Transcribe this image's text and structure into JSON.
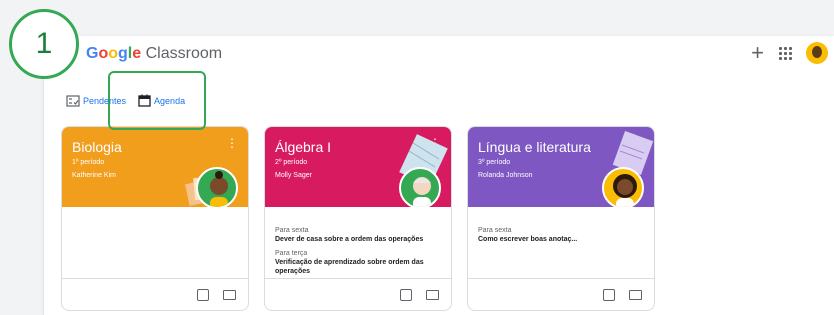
{
  "callout": {
    "number": "1"
  },
  "brand": {
    "title_parts": [
      "G",
      "o",
      "o",
      "g",
      "l",
      "e"
    ],
    "suffix": " Classroom"
  },
  "topbar": {
    "plus_label": "+"
  },
  "tabs": [
    {
      "label": "Pendentes",
      "icon": "todo-icon"
    },
    {
      "label": "Agenda",
      "icon": "calendar-icon"
    }
  ],
  "cards": [
    {
      "title": "Biologia",
      "period": "1º período",
      "teacher": "Katherine Kim",
      "color": "#f29e1d",
      "items": []
    },
    {
      "title": "Álgebra I",
      "period": "2º período",
      "teacher": "Molly Sager",
      "color": "#d81b60",
      "items": [
        {
          "due": "Para sexta",
          "text": "Dever de casa sobre a ordem das operações"
        },
        {
          "due": "Para terça",
          "text": "Verificação de aprendizado sobre ordem das operações"
        }
      ]
    },
    {
      "title": "Língua e literatura",
      "period": "3º período",
      "teacher": "Rolanda Johnson",
      "color": "#7e57c2",
      "items": [
        {
          "due": "Para sexta",
          "text": "Como escrever boas anotaç..."
        }
      ]
    }
  ]
}
